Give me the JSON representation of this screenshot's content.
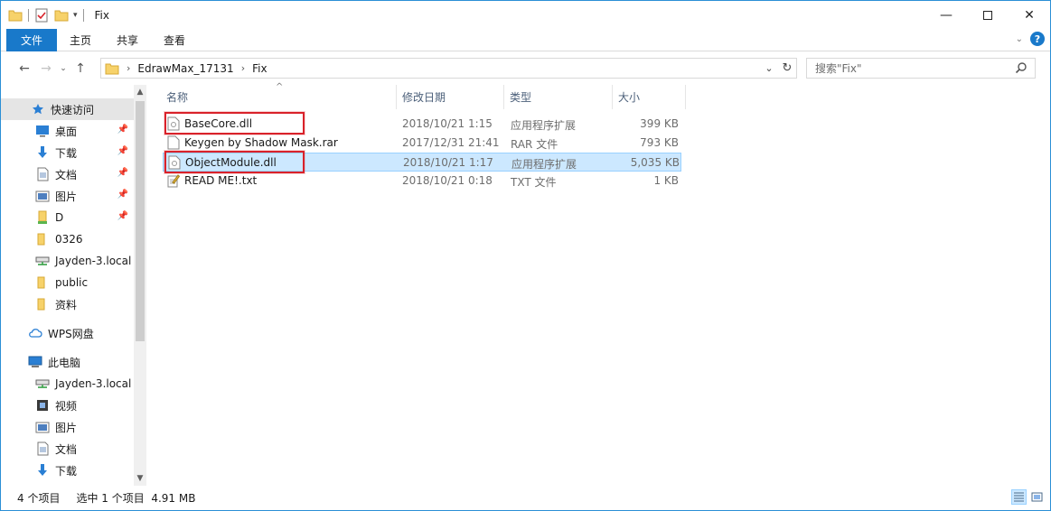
{
  "window": {
    "title": "Fix"
  },
  "ribbon": {
    "tabs": [
      "文件",
      "主页",
      "共享",
      "查看"
    ]
  },
  "address": {
    "crumbs": [
      "EdrawMax_17131",
      "Fix"
    ]
  },
  "search": {
    "placeholder": "搜索\"Fix\""
  },
  "sidebar": {
    "items": [
      {
        "label": "快速访问",
        "icon": "star-icon",
        "pinned": false
      },
      {
        "label": "桌面",
        "icon": "desktop-icon",
        "pinned": true
      },
      {
        "label": "下载",
        "icon": "download-icon",
        "pinned": true
      },
      {
        "label": "文档",
        "icon": "document-icon",
        "pinned": true
      },
      {
        "label": "图片",
        "icon": "pictures-icon",
        "pinned": true
      },
      {
        "label": "D",
        "icon": "drive-icon",
        "pinned": true
      },
      {
        "label": "0326",
        "icon": "folder-icon",
        "pinned": false
      },
      {
        "label": "Jayden-3.local",
        "icon": "network-drive-icon",
        "pinned": false
      },
      {
        "label": "public",
        "icon": "folder-icon",
        "pinned": false
      },
      {
        "label": "资料",
        "icon": "folder-icon",
        "pinned": false
      },
      {
        "label": "WPS网盘",
        "icon": "cloud-icon",
        "pinned": false
      },
      {
        "label": "此电脑",
        "icon": "computer-icon",
        "pinned": false
      },
      {
        "label": "Jayden-3.local",
        "icon": "network-drive-icon",
        "pinned": false
      },
      {
        "label": "视频",
        "icon": "video-icon",
        "pinned": false
      },
      {
        "label": "图片",
        "icon": "pictures-icon",
        "pinned": false
      },
      {
        "label": "文档",
        "icon": "document-icon",
        "pinned": false
      },
      {
        "label": "下载",
        "icon": "download-icon",
        "pinned": false
      }
    ]
  },
  "columns": {
    "name": "名称",
    "date": "修改日期",
    "type": "类型",
    "size": "大小"
  },
  "files": [
    {
      "name": "BaseCore.dll",
      "date": "2018/10/21 1:15",
      "type": "应用程序扩展",
      "size": "399 KB",
      "icon": "dll-file-icon"
    },
    {
      "name": "Keygen by Shadow Mask.rar",
      "date": "2017/12/31 21:41",
      "type": "RAR 文件",
      "size": "793 KB",
      "icon": "rar-file-icon"
    },
    {
      "name": "ObjectModule.dll",
      "date": "2018/10/21 1:17",
      "type": "应用程序扩展",
      "size": "5,035 KB",
      "icon": "dll-file-icon"
    },
    {
      "name": "READ ME!.txt",
      "date": "2018/10/21 0:18",
      "type": "TXT 文件",
      "size": "1 KB",
      "icon": "txt-file-icon"
    }
  ],
  "selected_file_index": 2,
  "status": {
    "item_count": "4 个项目",
    "selection": "选中 1 个项目  4.91 MB"
  },
  "colors": {
    "accent": "#1979ca",
    "selection": "#cce8ff",
    "highlight": "#d9222a"
  }
}
